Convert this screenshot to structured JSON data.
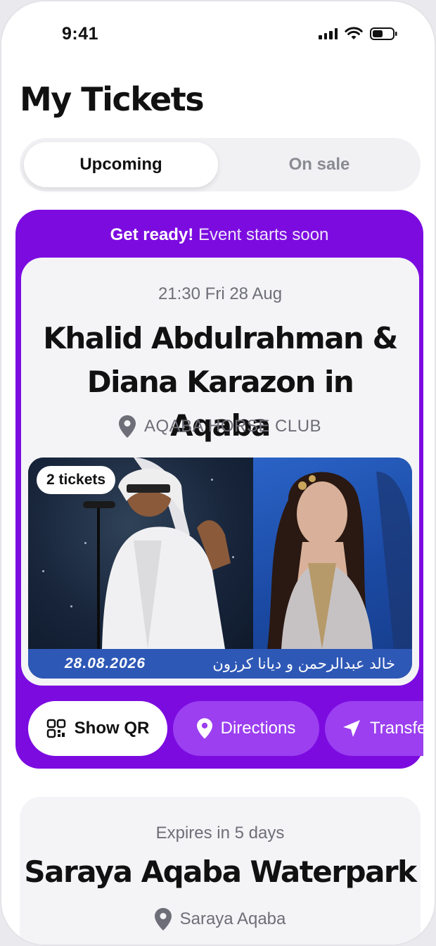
{
  "status_bar": {
    "time": "9:41"
  },
  "page": {
    "title": "My Tickets"
  },
  "tabs": [
    {
      "label": "Upcoming",
      "selected": true
    },
    {
      "label": "On sale",
      "selected": false
    }
  ],
  "featured": {
    "banner_bold": "Get ready!",
    "banner_text": "Event starts soon",
    "datetime": "21:30 Fri 28 Aug",
    "event_title_line1": "Khalid Abdulrahman &",
    "event_title_line2": "Diana Karazon in Aqaba",
    "venue": "AQABA HORSE CLUB",
    "ticket_count": "2 tickets",
    "poster_date": "28.08.2026",
    "poster_arabic": "خالد عبدالرحمن و ديانا كرزون",
    "actions": {
      "show_qr": "Show QR",
      "directions": "Directions",
      "transfer": "Transfer"
    }
  },
  "second_ticket": {
    "expiry": "Expires in 5 days",
    "event_title": "Saraya Aqaba Waterpark",
    "venue": "Saraya Aqaba"
  },
  "colors": {
    "accent_purple": "#7c0be0",
    "button_purple": "#9b3ff0",
    "card_bg": "#f4f4f7",
    "muted_text": "#6e6e78"
  }
}
